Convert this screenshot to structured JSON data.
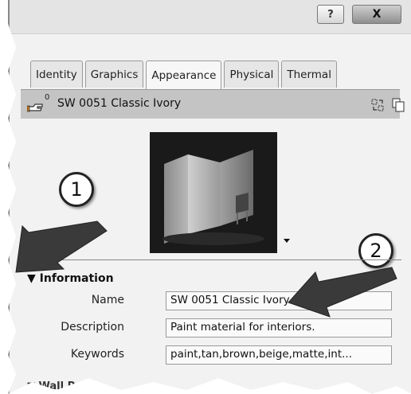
{
  "titlebar": {
    "help_label": "?",
    "close_label": "X"
  },
  "tabs": [
    {
      "label": "Identity"
    },
    {
      "label": "Graphics"
    },
    {
      "label": "Appearance",
      "active": true
    },
    {
      "label": "Physical"
    },
    {
      "label": "Thermal"
    }
  ],
  "asset": {
    "usage_count": "0",
    "name": "SW 0051 Classic Ivory"
  },
  "callouts": {
    "first": "1",
    "second": "2"
  },
  "information": {
    "header": "Information",
    "fields": {
      "name_label": "Name",
      "name_value": "SW 0051 Classic Ivory",
      "description_label": "Description",
      "description_value": "Paint material for interiors.",
      "keywords_label": "Keywords",
      "keywords_value": "paint,tan,brown,beige,matte,int..."
    }
  },
  "next_section": {
    "header": "Wall Paint"
  }
}
